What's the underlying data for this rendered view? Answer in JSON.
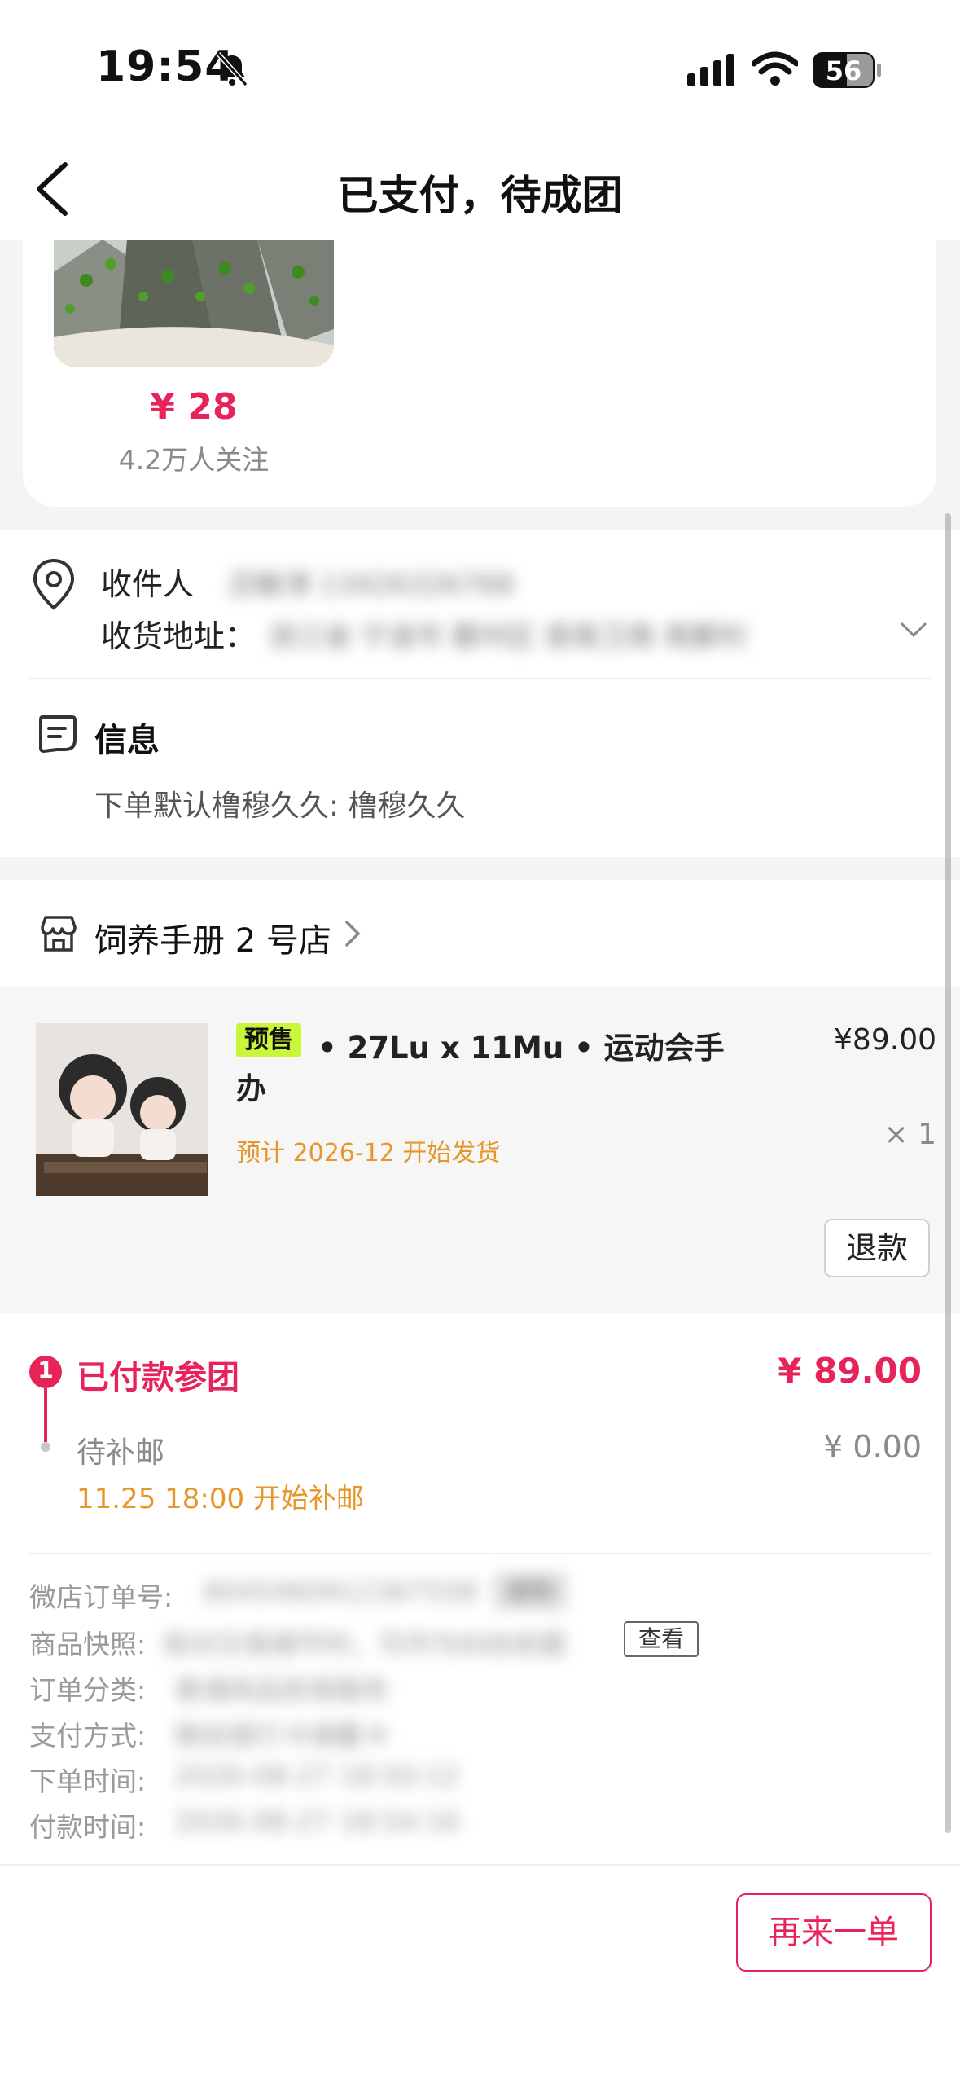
{
  "status_bar": {
    "time": "19:54",
    "battery": "56"
  },
  "nav": {
    "title": "已支付，待成团"
  },
  "recommend": {
    "price": "¥ 28",
    "followers": "4.2万人关注"
  },
  "address": {
    "recipient_label": "收件人",
    "recipient_value": "吕敏涛 13426326768",
    "address_label": "收货地址：",
    "address_value": "浙江省 宁波市 鄞州区 首南卫南 南鄞村"
  },
  "info": {
    "title": "信息",
    "text": "下单默认橹穆久久: 橹穆久久"
  },
  "store": {
    "name": "饲养手册 2 号店"
  },
  "product": {
    "badge": "预售",
    "title_line1": "• 27Lu x 11Mu • 运动会手",
    "title_line2": "办",
    "price": "¥89.00",
    "qty": "× 1",
    "ship_note": "预计 2026-12 开始发货",
    "refund_label": "退款"
  },
  "payment": {
    "step_number": "1",
    "paid_label": "已付款参团",
    "paid_amount": "¥ 89.00",
    "pending_label": "待补邮",
    "pending_amount": "¥ 0.00",
    "pending_note": "11.25 18:00 开始补邮"
  },
  "details": {
    "order_no_label": "微店订单号:",
    "order_no_value": "8045460912367558",
    "copy_label": "复制",
    "snapshot_label": "商品快照:",
    "snapshot_value": "核对交易细节时，可作为纠纷依据",
    "snapshot_btn": "查看",
    "category_label": "订单分类:",
    "category_value": "普通商品担保服务",
    "pay_label": "支付方式:",
    "pay_value": "微信银行卡储蓄卡",
    "order_time_label": "下单时间:",
    "order_time_value": "2026-08-27 18:50:12",
    "paid_time_label": "付款时间:",
    "paid_time_value": "2026-08-27 18:54:16"
  },
  "footer": {
    "reorder_label": "再来一单"
  }
}
